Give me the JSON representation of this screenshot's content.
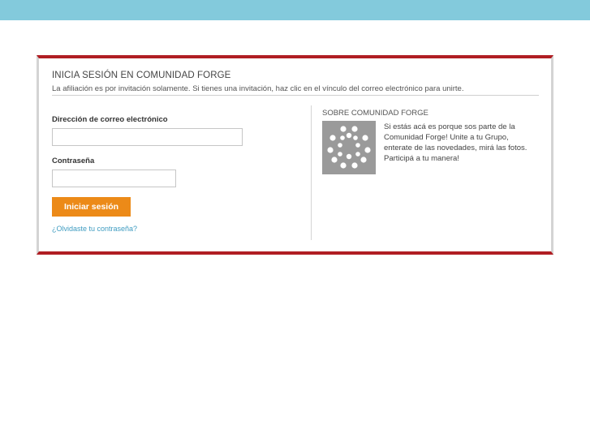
{
  "header": {
    "title": "INICIA SESIÓN EN COMUNIDAD FORGE",
    "subtitle": "La afiliación es por invitación solamente. Si tienes una invitación, haz clic en el vínculo del correo electrónico para unirte."
  },
  "login_form": {
    "email_label": "Dirección de correo electrónico",
    "email_value": "",
    "password_label": "Contraseña",
    "password_value": "",
    "submit_label": "Iniciar sesión",
    "forgot_link": "¿Olvidaste tu contraseña?"
  },
  "about": {
    "title": "SOBRE COMUNIDAD FORGE",
    "logo_icon": "dot-circle-logo-icon",
    "description": "Si estás acá es porque sos parte de la Comunidad Forge! Unite a tu Grupo, enterate de las novedades, mirá las fotos. Participá a tu manera!"
  },
  "colors": {
    "top_bar": "#83cadc",
    "card_border": "#b01e23",
    "button": "#ec8a18",
    "link": "#3f9cc1",
    "logo_bg": "#9a9a9a"
  }
}
